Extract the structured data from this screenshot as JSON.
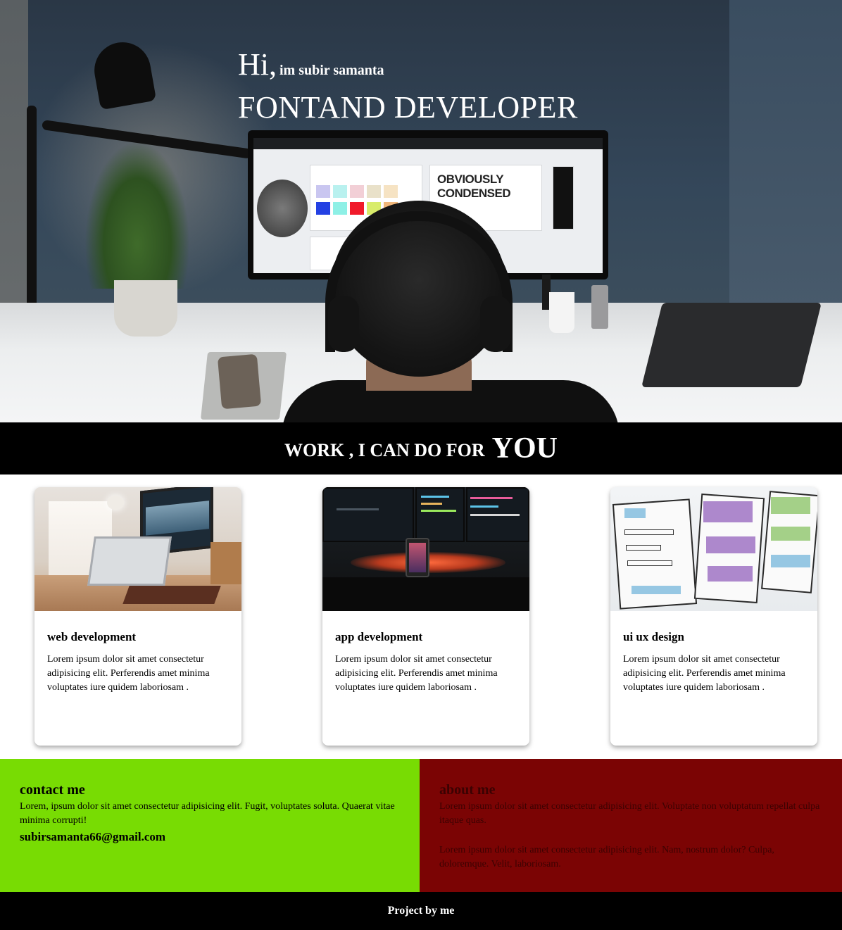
{
  "hero": {
    "greeting": "Hi,",
    "intro": "im subir samanta",
    "role": "FONTAND DEVELOPER",
    "screen_text": "OBVIOUSLY CONDENSED"
  },
  "banner": {
    "text": "WORK , I CAN DO FOR",
    "emphasis": "YOU"
  },
  "services": [
    {
      "title": "web development",
      "description": "Lorem ipsum dolor sit amet consectetur adipisicing elit. Perferendis amet minima voluptates iure quidem laboriosam ."
    },
    {
      "title": "app development",
      "description": "Lorem ipsum dolor sit amet consectetur adipisicing elit. Perferendis amet minima voluptates iure quidem laboriosam ."
    },
    {
      "title": "ui ux design",
      "description": "Lorem ipsum dolor sit amet consectetur adipisicing elit. Perferendis amet minima voluptates iure quidem laboriosam ."
    }
  ],
  "contact": {
    "heading": "contact me",
    "text": "Lorem, ipsum dolor sit amet consectetur adipisicing elit. Fugit, voluptates soluta. Quaerat vitae minima corrupti!",
    "email": "subirsamanta66@gmail.com"
  },
  "about": {
    "heading": "about me",
    "paragraph1": "Lorem ipsum dolor sit amet consectetur adipisicing elit. Voluptate non voluptatum repellat culpa itaque quas.",
    "paragraph2": "Lorem ipsum dolor sit amet consectetur adipisicing elit. Nam, nostrum dolor? Culpa, doloremque. Velit, laboriosam."
  },
  "footer": {
    "text": "Project by me"
  },
  "colors": {
    "contact_bg": "#78dc03",
    "about_bg": "#7b0404",
    "about_text": "#3b0202",
    "banner_bg": "#000000"
  }
}
